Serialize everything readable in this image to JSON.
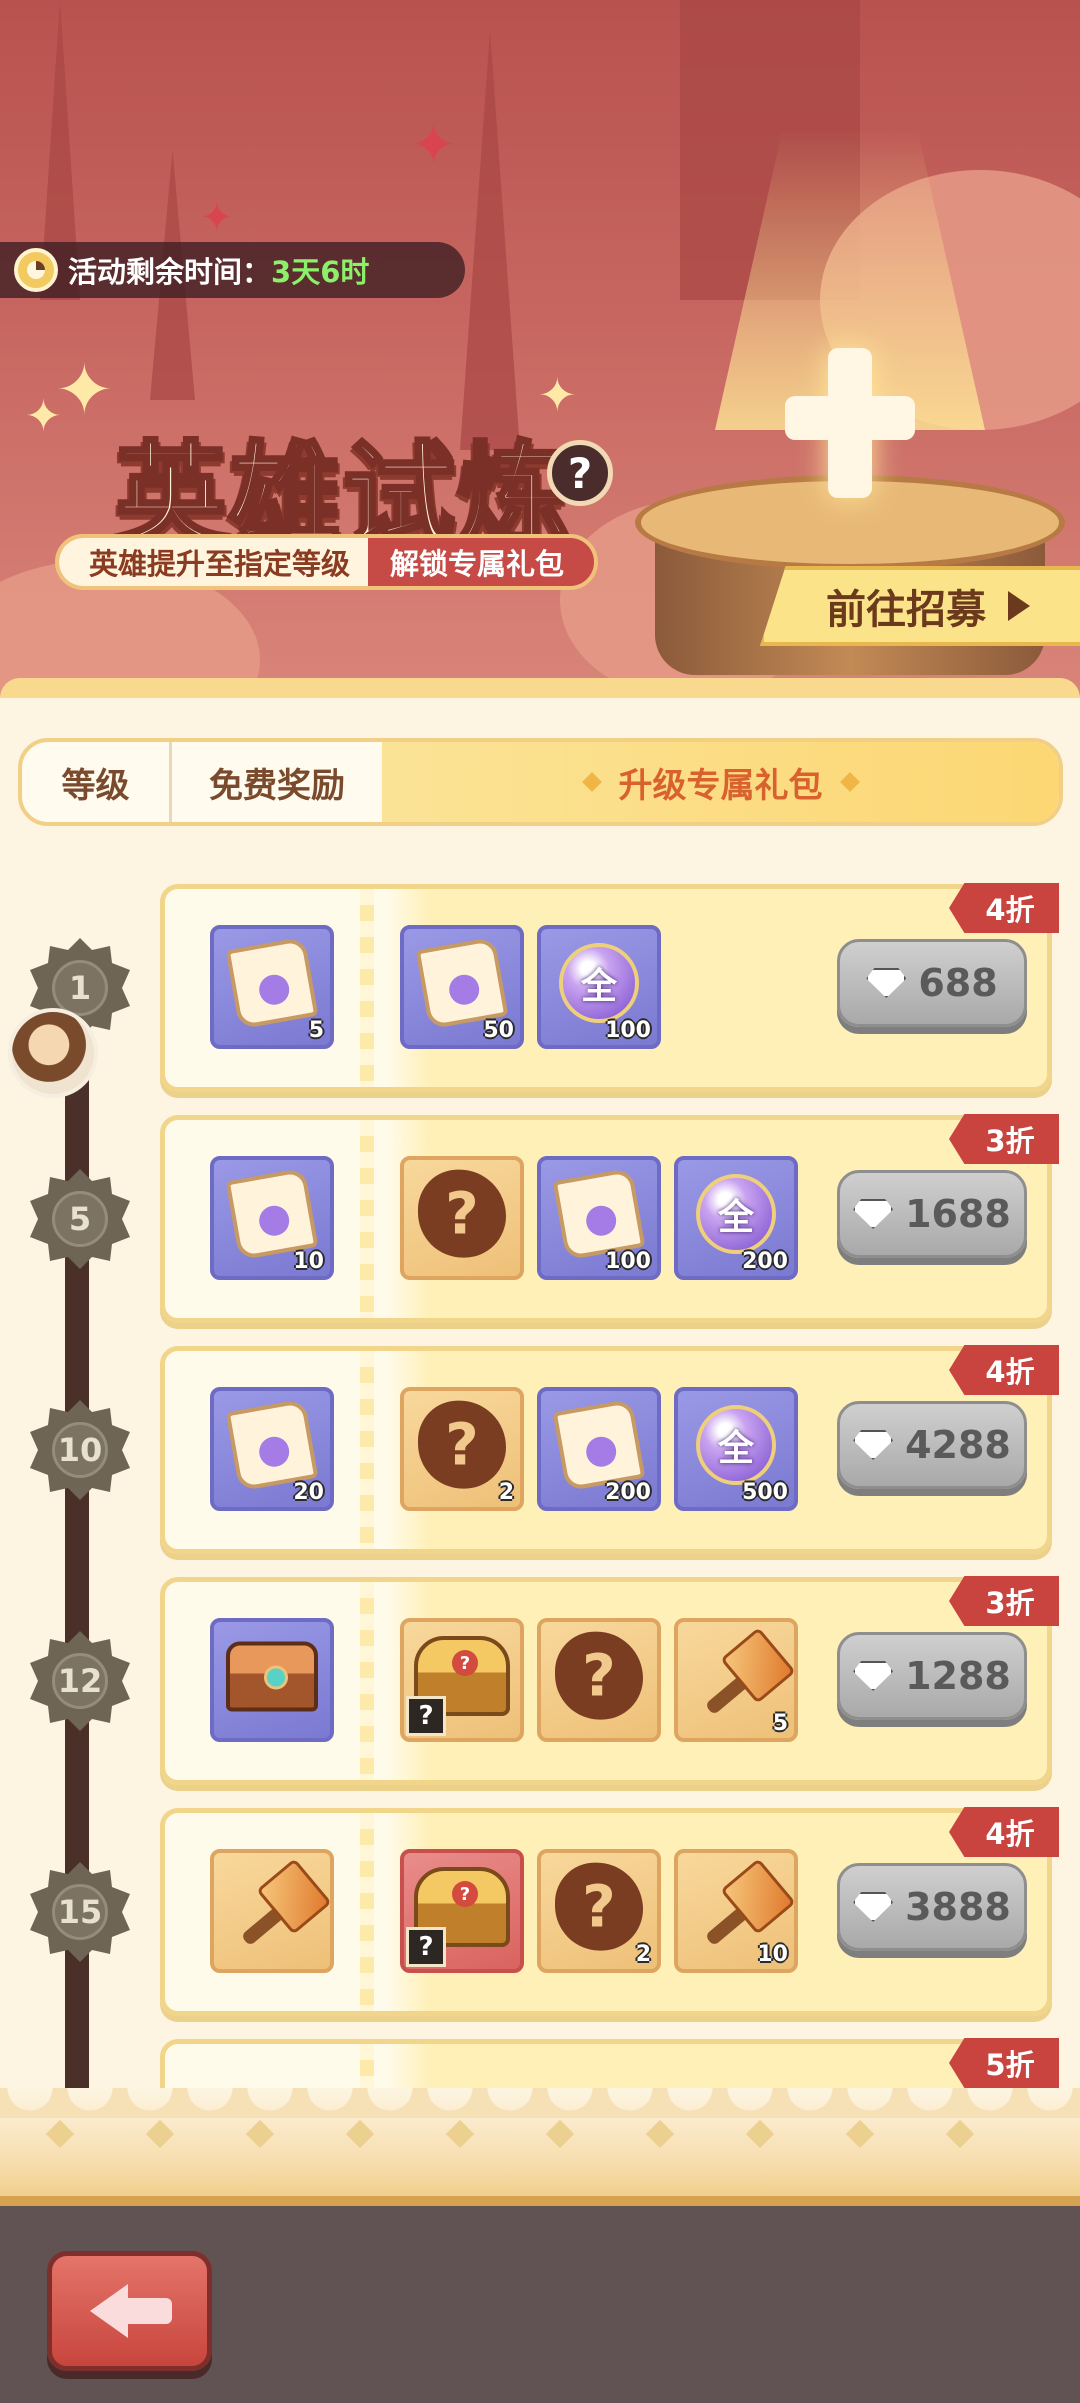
{
  "banner": {
    "timer_label": "活动剩余时间：",
    "timer_value": "3天6时",
    "title": "英雄试炼",
    "help_label": "?",
    "subtitle_left": "英雄提升至指定等级",
    "subtitle_right": "解锁专属礼包",
    "recruit_label": "前往招募"
  },
  "tabs": {
    "level": "等级",
    "free_rewards": "免费奖励",
    "exclusive_pack": "升级专属礼包"
  },
  "packs": [
    {
      "level": "1",
      "discount": "4折",
      "price": "688",
      "free_item": {
        "icon": "integral-scroll-icon",
        "qty": "5"
      },
      "items": [
        {
          "icon": "integral-scroll-icon",
          "qty": "50"
        },
        {
          "icon": "universal-orb-icon",
          "label": "全",
          "qty": "100"
        }
      ]
    },
    {
      "level": "5",
      "discount": "3折",
      "price": "1688",
      "free_item": {
        "icon": "integral-scroll-icon",
        "qty": "10"
      },
      "items": [
        {
          "icon": "mystery-icon",
          "qty": ""
        },
        {
          "icon": "integral-scroll-icon",
          "qty": "100"
        },
        {
          "icon": "universal-orb-icon",
          "label": "全",
          "qty": "200"
        }
      ]
    },
    {
      "level": "10",
      "discount": "4折",
      "price": "4288",
      "free_item": {
        "icon": "integral-scroll-icon",
        "qty": "20"
      },
      "items": [
        {
          "icon": "mystery-icon",
          "qty": "2"
        },
        {
          "icon": "integral-scroll-icon",
          "qty": "200"
        },
        {
          "icon": "universal-orb-icon",
          "label": "全",
          "qty": "500"
        }
      ]
    },
    {
      "level": "12",
      "discount": "3折",
      "price": "1288",
      "free_item": {
        "icon": "treasure-chest-icon",
        "qty": ""
      },
      "items": [
        {
          "icon": "gold-chest-icon",
          "qty": ""
        },
        {
          "icon": "mystery-icon",
          "qty": ""
        },
        {
          "icon": "hammer-icon",
          "qty": "5"
        }
      ]
    },
    {
      "level": "15",
      "discount": "4折",
      "price": "3888",
      "free_item": {
        "icon": "hammer-icon",
        "qty": ""
      },
      "items": [
        {
          "icon": "red-chest-icon",
          "qty": ""
        },
        {
          "icon": "mystery-icon",
          "qty": "2"
        },
        {
          "icon": "hammer-icon",
          "qty": "10"
        }
      ]
    },
    {
      "level": "",
      "discount": "5折",
      "price": ""
    }
  ],
  "colors": {
    "timer_value": "#8cf06a",
    "discount_tag": "#c9433f",
    "active_tab_text": "#d9612e"
  }
}
